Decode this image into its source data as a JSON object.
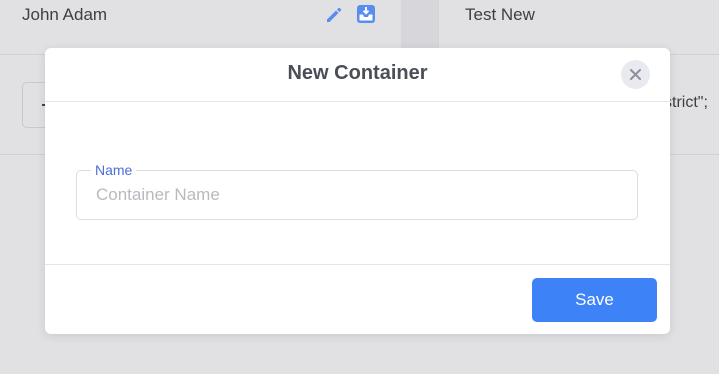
{
  "background": {
    "left_card_title": "John Adam",
    "right_card_title": "Test New",
    "code_snippet": "strict\";"
  },
  "modal": {
    "title": "New Container",
    "close_icon": "close-icon",
    "name_field": {
      "label": "Name",
      "placeholder": "Container Name",
      "value": ""
    },
    "save_label": "Save"
  },
  "colors": {
    "accent": "#3d82f7",
    "label_blue": "#4a6fd6",
    "icon_blue": "#5b8def"
  }
}
